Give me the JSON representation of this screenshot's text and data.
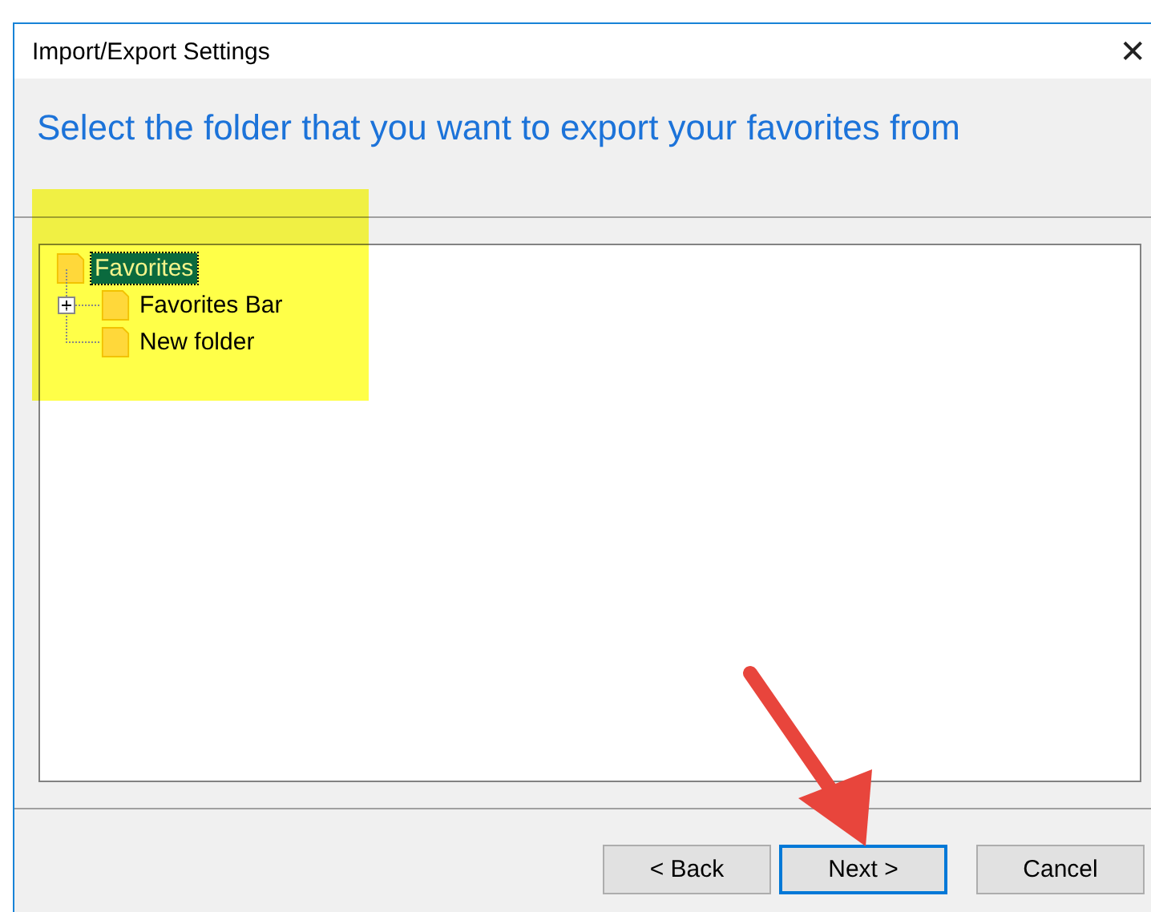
{
  "window": {
    "title": "Import/Export Settings",
    "close": "✕"
  },
  "heading": "Select the folder that you want to export your favorites from",
  "tree": [
    {
      "label": "Favorites",
      "selected": true,
      "children": [
        {
          "label": "Favorites Bar",
          "selected": false,
          "expanded": false
        },
        {
          "label": "New folder",
          "selected": false
        }
      ]
    }
  ],
  "buttons": [
    {
      "label": "< Back",
      "focused": false
    },
    {
      "label": "Next >",
      "focused": true
    },
    {
      "label": "Cancel",
      "focused": false
    }
  ]
}
